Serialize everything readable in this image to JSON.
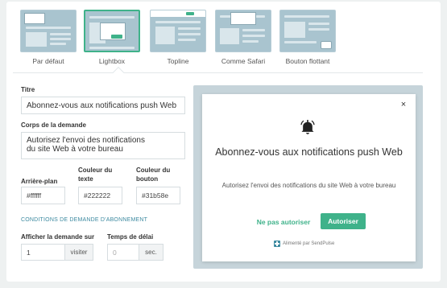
{
  "templates": [
    {
      "label": "Par défaut",
      "active": false
    },
    {
      "label": "Lightbox",
      "active": true
    },
    {
      "label": "Topline",
      "active": false
    },
    {
      "label": "Comme Safari",
      "active": false
    },
    {
      "label": "Bouton flottant",
      "active": false
    }
  ],
  "form": {
    "title_label": "Titre",
    "title_value": "Abonnez-vous aux notifications push Web",
    "body_label": "Corps de la demande",
    "body_value": "Autorisez l'envoi des notifications\ndu site Web à votre bureau",
    "bg_label": "Arrière-plan",
    "bg_value": "#ffffff",
    "text_color_label": "Couleur du texte",
    "text_color_value": "#222222",
    "button_color_label": "Couleur du bouton",
    "button_color_value": "#31b58e",
    "conditions_title": "CONDITIONS DE DEMANDE D'ABONNEMENT",
    "show_on_label": "Afficher la demande sur",
    "show_on_value": "1",
    "show_on_suffix": "visiter",
    "delay_label": "Temps de délai",
    "delay_placeholder": "0",
    "delay_suffix": "sec."
  },
  "preview": {
    "close": "×",
    "title": "Abonnez-vous aux notifications push Web",
    "body": "Autorisez l'envoi des notifications du site Web à votre bureau",
    "deny_label": "Ne pas autoriser",
    "allow_label": "Autoriser",
    "branding": "Alimenté par SendPulse"
  },
  "colors": {
    "accent": "#3fb28a",
    "preview_bg": "#c6d4da",
    "thumb_bg": "#a9c4cf"
  },
  "icons": {
    "bell": "bell-icon",
    "close": "close-icon",
    "brand": "sendpulse-logo-icon"
  }
}
